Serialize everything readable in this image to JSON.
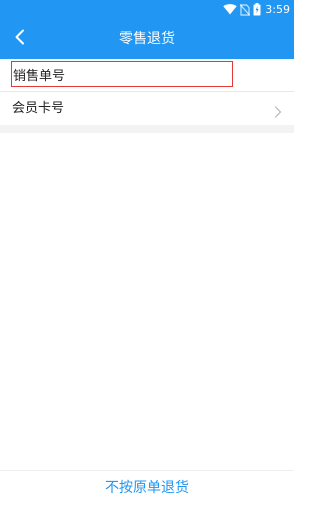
{
  "status_bar": {
    "time": "3:59",
    "icons": [
      "wifi-icon",
      "no-sim-icon",
      "battery-icon"
    ]
  },
  "header": {
    "back_icon": "chevron-left-icon",
    "title": "零售退货"
  },
  "form": {
    "sales_order_label": "销售单号",
    "member_card_label": "会员卡号",
    "member_card_icon": "chevron-right-icon"
  },
  "footer": {
    "action_label": "不按原单退货"
  },
  "colors": {
    "primary": "#2196f3",
    "highlight_border": "#e53935",
    "text": "#222222",
    "divider": "#e8e8e8"
  }
}
